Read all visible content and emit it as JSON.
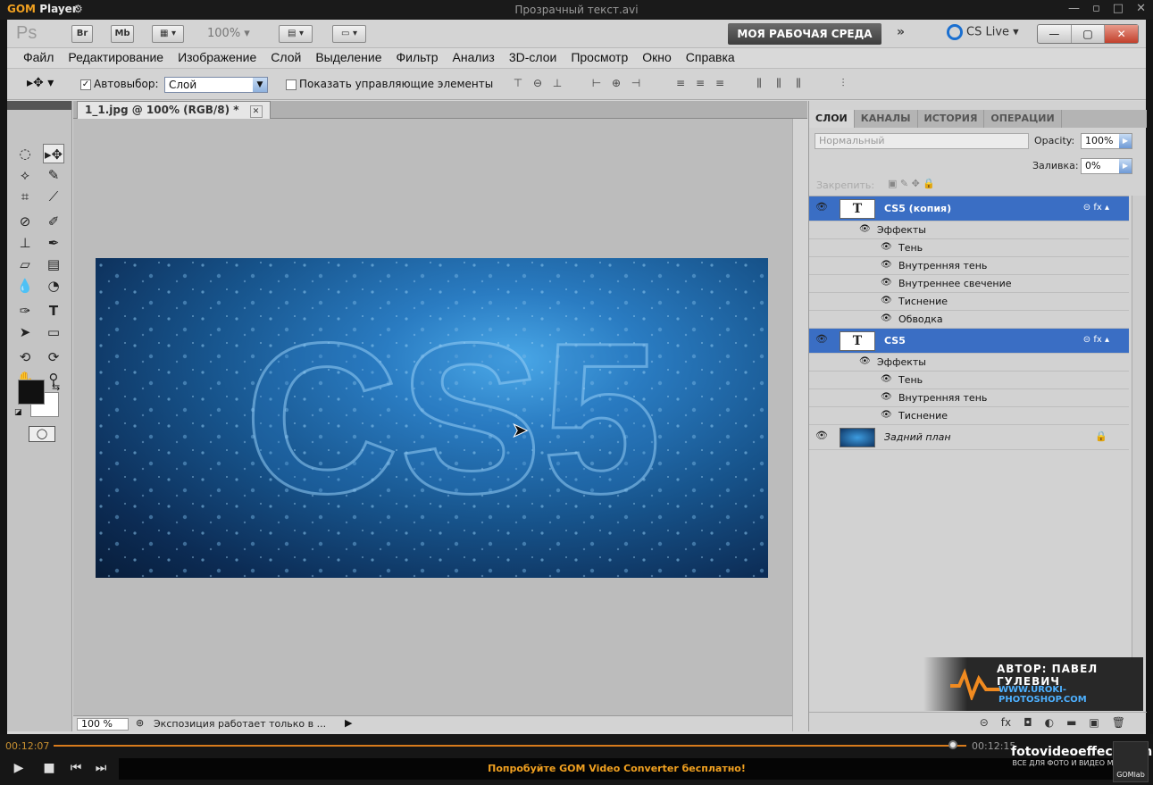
{
  "gom": {
    "logo": "GOM",
    "logo_sub": "Player",
    "filename": "Прозрачный текст.avi",
    "time_elapsed": "00:12:07",
    "time_total": "00:12:15",
    "progress": 0.99,
    "promo": "Попробуйте GOM Video Converter бесплатно!",
    "brand_site": "fotovideoeffect.com",
    "brand_tagline": "ВСЕ ДЛЯ ФОТО И ВИДЕО МОНТАЖА!",
    "lab": "GOMlab"
  },
  "ps": {
    "logo": "Ps",
    "br": "Br",
    "mb": "Mb",
    "zoom": "100%",
    "workspace": "МОЯ РАБОЧАЯ СРЕДА",
    "cslive": "CS Live",
    "menu": [
      "Файл",
      "Редактирование",
      "Изображение",
      "Слой",
      "Выделение",
      "Фильтр",
      "Анализ",
      "3D-слои",
      "Просмотр",
      "Окно",
      "Справка"
    ],
    "options": {
      "autoselect": "Автовыбор:",
      "autoselect_value": "Слой",
      "show_controls": "Показать управляющие элементы"
    },
    "doc": {
      "tab": "1_1.jpg @ 100% (RGB/8) *",
      "canvas_text": "CS5",
      "zoom_status": "100 %",
      "status": "Экспозиция работает только в ..."
    },
    "panels": {
      "tabs": [
        "СЛОИ",
        "КАНАЛЫ",
        "ИСТОРИЯ",
        "ОПЕРАЦИИ"
      ],
      "blend": "Нормальный",
      "opacity_label": "Opacity:",
      "opacity": "100%",
      "lock_label": "Закрепить:",
      "fill_label": "Заливка:",
      "fill": "0%",
      "layers": [
        {
          "name": "CS5 (копия)",
          "effects_label": "Эффекты",
          "effects": [
            "Тень",
            "Внутренняя тень",
            "Внутреннее свечение",
            "Тиснение",
            "Обводка"
          ]
        },
        {
          "name": "CS5",
          "effects_label": "Эффекты",
          "effects": [
            "Тень",
            "Внутренняя тень",
            "Тиснение"
          ]
        },
        {
          "name": "Задний план"
        }
      ]
    },
    "watermark": {
      "author": "АВТОР: ПАВЕЛ ГУЛЕВИЧ",
      "url": "WWW.UROKI-PHOTOSHOP.COM"
    }
  }
}
